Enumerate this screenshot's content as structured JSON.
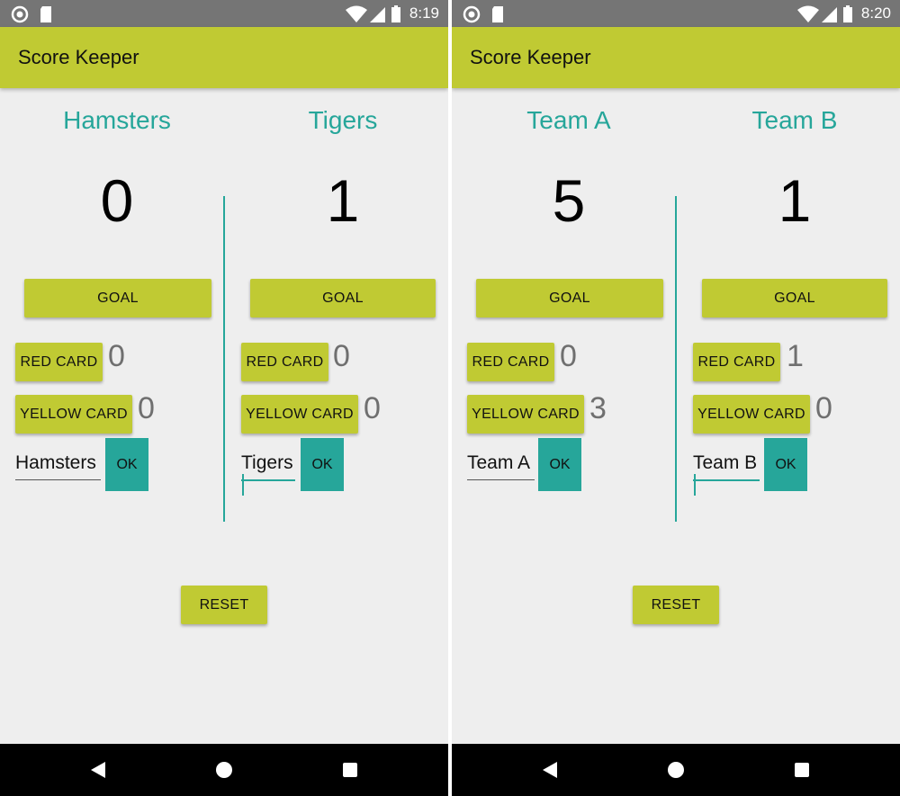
{
  "colors": {
    "accent": "#c0ca33",
    "teal": "#26a69a",
    "statusbar": "#757575",
    "background": "#eeeeee"
  },
  "screens": [
    {
      "status": {
        "time": "8:19",
        "icons": [
          "circle-icon",
          "sd-card-icon",
          "wifi-icon",
          "signal-icon",
          "battery-icon"
        ]
      },
      "app_title": "Score Keeper",
      "teams": [
        {
          "name": "Hamsters",
          "score": "0",
          "goal_label": "GOAL",
          "red_card_label": "RED CARD",
          "red_count": "0",
          "yellow_card_label": "YELLOW CARD",
          "yellow_count": "0",
          "name_input_value": "Hamsters",
          "ok_label": "OK"
        },
        {
          "name": "Tigers",
          "score": "1",
          "goal_label": "GOAL",
          "red_card_label": "RED CARD",
          "red_count": "0",
          "yellow_card_label": "YELLOW CARD",
          "yellow_count": "0",
          "name_input_value": "Tigers",
          "ok_label": "OK"
        }
      ],
      "reset_label": "RESET"
    },
    {
      "status": {
        "time": "8:20",
        "icons": [
          "circle-icon",
          "sd-card-icon",
          "wifi-icon",
          "signal-icon",
          "battery-icon"
        ]
      },
      "app_title": "Score Keeper",
      "teams": [
        {
          "name": "Team A",
          "score": "5",
          "goal_label": "GOAL",
          "red_card_label": "RED CARD",
          "red_count": "0",
          "yellow_card_label": "YELLOW CARD",
          "yellow_count": "3",
          "name_input_value": "Team A",
          "ok_label": "OK"
        },
        {
          "name": "Team B",
          "score": "1",
          "goal_label": "GOAL",
          "red_card_label": "RED CARD",
          "red_count": "1",
          "yellow_card_label": "YELLOW CARD",
          "yellow_count": "0",
          "name_input_value": "Team B",
          "ok_label": "OK"
        }
      ],
      "reset_label": "RESET"
    }
  ],
  "navbar": {
    "icons": [
      "back-icon",
      "home-icon",
      "recents-icon"
    ]
  }
}
